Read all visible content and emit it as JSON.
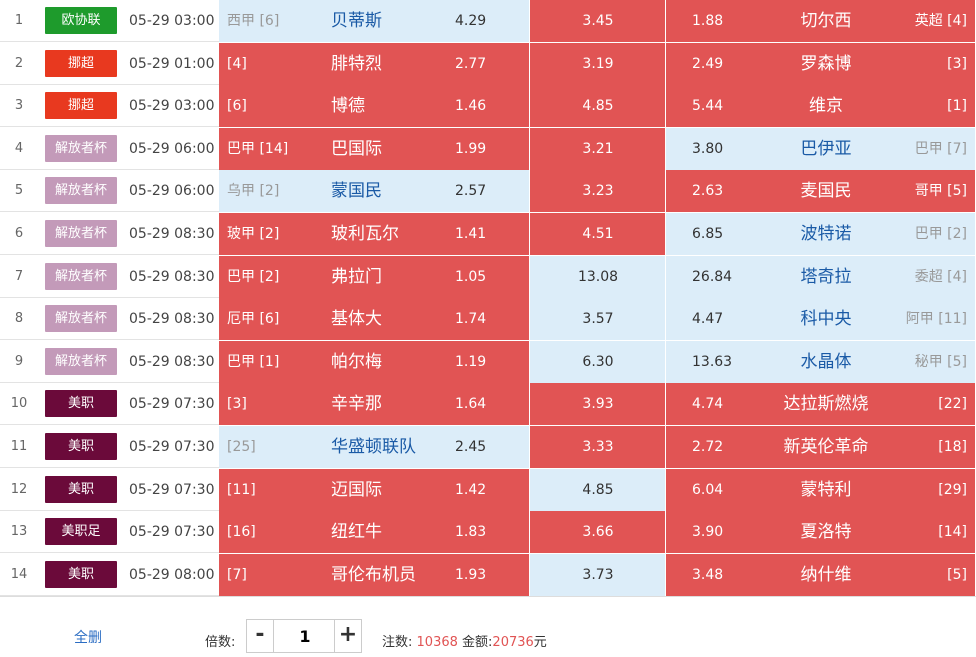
{
  "rows": [
    {
      "idx": "1",
      "league": "欧协联",
      "color": "#1e9b2c",
      "time": "05-29 03:00",
      "home": {
        "rank": "西甲 [6]",
        "name": "贝蒂斯",
        "odds": "4.29",
        "hot": false
      },
      "draw": {
        "odds": "3.45",
        "hot": true
      },
      "away": {
        "odds": "1.88",
        "name": "切尔西",
        "rank": "英超 [4]",
        "hot": true
      }
    },
    {
      "idx": "2",
      "league": "挪超",
      "color": "#e8391f",
      "time": "05-29 01:00",
      "home": {
        "rank": "[4]",
        "name": "腓特烈",
        "odds": "2.77",
        "hot": true
      },
      "draw": {
        "odds": "3.19",
        "hot": true
      },
      "away": {
        "odds": "2.49",
        "name": "罗森博",
        "rank": "[3]",
        "hot": true
      }
    },
    {
      "idx": "3",
      "league": "挪超",
      "color": "#e8391f",
      "time": "05-29 03:00",
      "home": {
        "rank": "[6]",
        "name": "博德",
        "odds": "1.46",
        "hot": true
      },
      "draw": {
        "odds": "4.85",
        "hot": true
      },
      "away": {
        "odds": "5.44",
        "name": "维京",
        "rank": "[1]",
        "hot": true
      }
    },
    {
      "idx": "4",
      "league": "解放者杯",
      "color": "#c39ab9",
      "time": "05-29 06:00",
      "home": {
        "rank": "巴甲 [14]",
        "name": "巴国际",
        "odds": "1.99",
        "hot": true
      },
      "draw": {
        "odds": "3.21",
        "hot": true
      },
      "away": {
        "odds": "3.80",
        "name": "巴伊亚",
        "rank": "巴甲 [7]",
        "hot": false
      }
    },
    {
      "idx": "5",
      "league": "解放者杯",
      "color": "#c39ab9",
      "time": "05-29 06:00",
      "home": {
        "rank": "乌甲 [2]",
        "name": "蒙国民",
        "odds": "2.57",
        "hot": false
      },
      "draw": {
        "odds": "3.23",
        "hot": true
      },
      "away": {
        "odds": "2.63",
        "name": "麦国民",
        "rank": "哥甲 [5]",
        "hot": true
      }
    },
    {
      "idx": "6",
      "league": "解放者杯",
      "color": "#c39ab9",
      "time": "05-29 08:30",
      "home": {
        "rank": "玻甲 [2]",
        "name": "玻利瓦尔",
        "odds": "1.41",
        "hot": true
      },
      "draw": {
        "odds": "4.51",
        "hot": true
      },
      "away": {
        "odds": "6.85",
        "name": "波特诺",
        "rank": "巴甲 [2]",
        "hot": false
      }
    },
    {
      "idx": "7",
      "league": "解放者杯",
      "color": "#c39ab9",
      "time": "05-29 08:30",
      "home": {
        "rank": "巴甲 [2]",
        "name": "弗拉门",
        "odds": "1.05",
        "hot": true
      },
      "draw": {
        "odds": "13.08",
        "hot": false
      },
      "away": {
        "odds": "26.84",
        "name": "塔奇拉",
        "rank": "委超 [4]",
        "hot": false
      }
    },
    {
      "idx": "8",
      "league": "解放者杯",
      "color": "#c39ab9",
      "time": "05-29 08:30",
      "home": {
        "rank": "厄甲 [6]",
        "name": "基体大",
        "odds": "1.74",
        "hot": true
      },
      "draw": {
        "odds": "3.57",
        "hot": false
      },
      "away": {
        "odds": "4.47",
        "name": "科中央",
        "rank": "阿甲 [11]",
        "hot": false
      }
    },
    {
      "idx": "9",
      "league": "解放者杯",
      "color": "#c39ab9",
      "time": "05-29 08:30",
      "home": {
        "rank": "巴甲 [1]",
        "name": "帕尔梅",
        "odds": "1.19",
        "hot": true
      },
      "draw": {
        "odds": "6.30",
        "hot": false
      },
      "away": {
        "odds": "13.63",
        "name": "水晶体",
        "rank": "秘甲 [5]",
        "hot": false
      }
    },
    {
      "idx": "10",
      "league": "美职",
      "color": "#6b0a3a",
      "time": "05-29 07:30",
      "home": {
        "rank": "[3]",
        "name": "辛辛那",
        "odds": "1.64",
        "hot": true
      },
      "draw": {
        "odds": "3.93",
        "hot": true
      },
      "away": {
        "odds": "4.74",
        "name": "达拉斯燃烧",
        "rank": "[22]",
        "hot": true
      }
    },
    {
      "idx": "11",
      "league": "美职",
      "color": "#6b0a3a",
      "time": "05-29 07:30",
      "home": {
        "rank": "[25]",
        "name": "华盛顿联队",
        "odds": "2.45",
        "hot": false
      },
      "draw": {
        "odds": "3.33",
        "hot": true
      },
      "away": {
        "odds": "2.72",
        "name": "新英伦革命",
        "rank": "[18]",
        "hot": true
      }
    },
    {
      "idx": "12",
      "league": "美职",
      "color": "#6b0a3a",
      "time": "05-29 07:30",
      "home": {
        "rank": "[11]",
        "name": "迈国际",
        "odds": "1.42",
        "hot": true
      },
      "draw": {
        "odds": "4.85",
        "hot": false
      },
      "away": {
        "odds": "6.04",
        "name": "蒙特利",
        "rank": "[29]",
        "hot": true
      }
    },
    {
      "idx": "13",
      "league": "美职足",
      "color": "#6b0a3a",
      "time": "05-29 07:30",
      "home": {
        "rank": "[16]",
        "name": "纽红牛",
        "odds": "1.83",
        "hot": true
      },
      "draw": {
        "odds": "3.66",
        "hot": true
      },
      "away": {
        "odds": "3.90",
        "name": "夏洛特",
        "rank": "[14]",
        "hot": true
      }
    },
    {
      "idx": "14",
      "league": "美职",
      "color": "#6b0a3a",
      "time": "05-29 08:00",
      "home": {
        "rank": "[7]",
        "name": "哥伦布机员",
        "odds": "1.93",
        "hot": true
      },
      "draw": {
        "odds": "3.73",
        "hot": false
      },
      "away": {
        "odds": "3.48",
        "name": "纳什维",
        "rank": "[5]",
        "hot": true
      }
    }
  ],
  "footer": {
    "delete_all": "全删",
    "multiplier_label": "倍数:",
    "minus": "-",
    "plus": "+",
    "multiplier_value": "1",
    "bets_label": "注数:",
    "bets_value": "10368",
    "amount_label": "金额:",
    "amount_value": "20736",
    "currency": "元"
  }
}
